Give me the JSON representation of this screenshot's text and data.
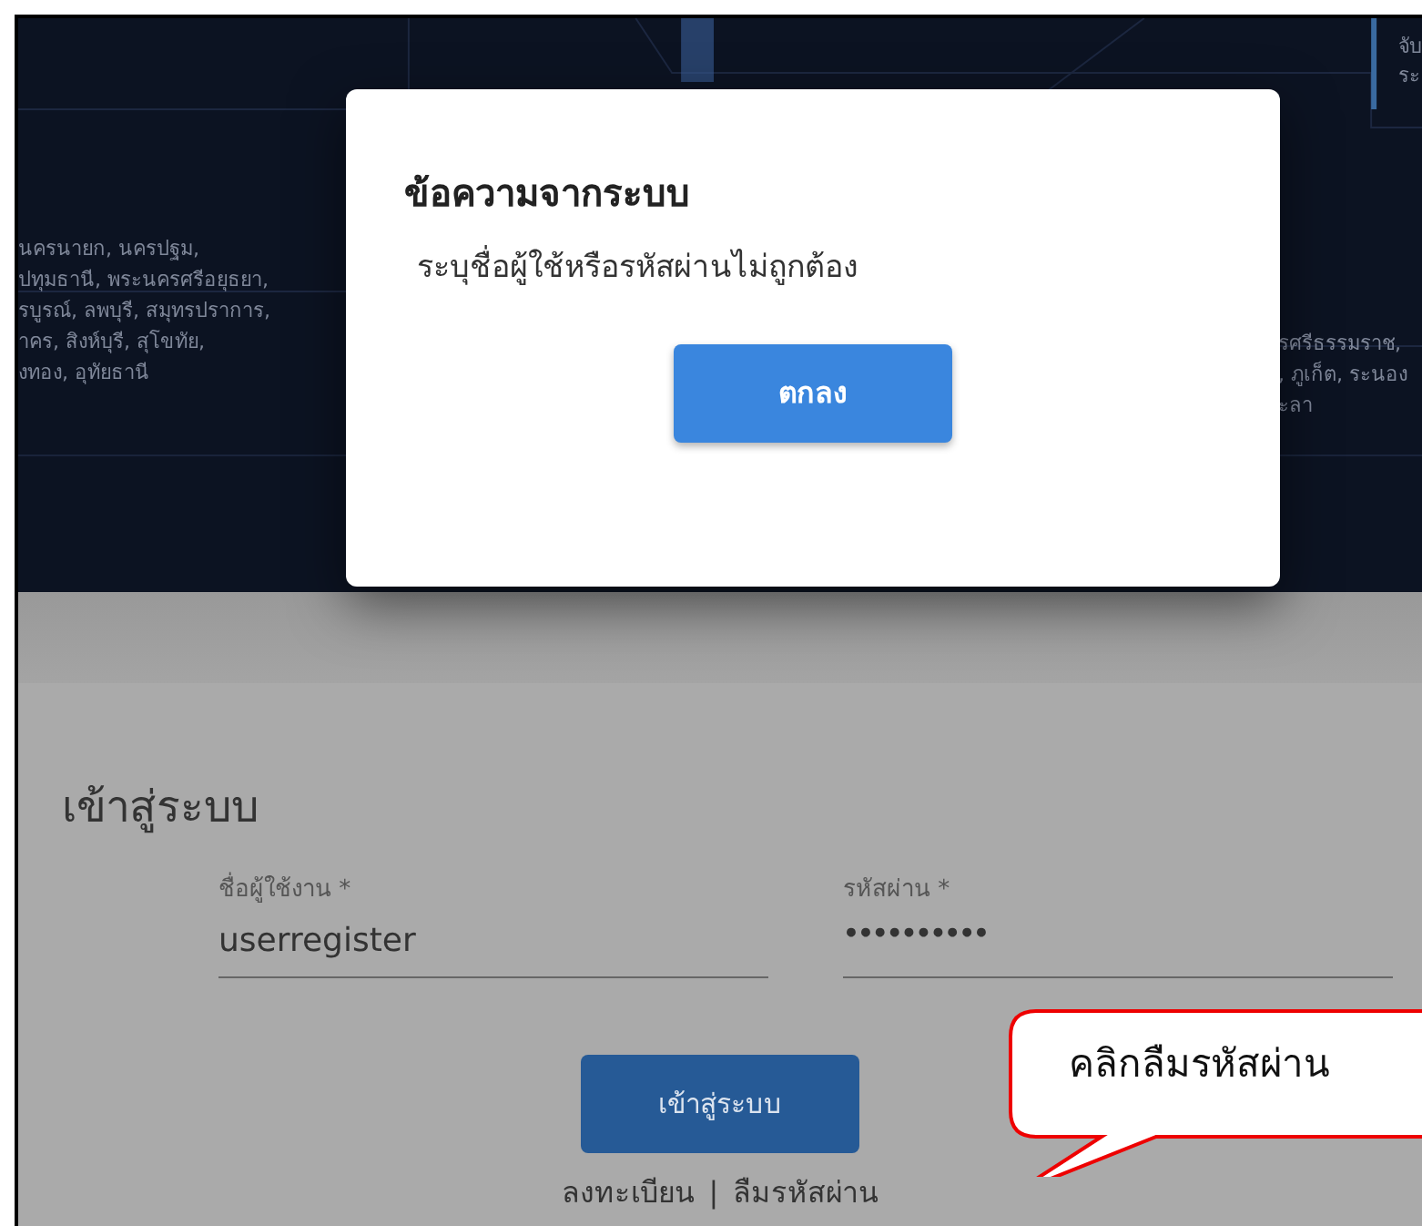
{
  "banner": {
    "left_lines": [
      "นครนายก, นครปฐม,",
      "ปทุมธานี, พระนครศรีอยุธยา,",
      "รบูรณ์, ลพบุรี, สมุทรปราการ,",
      "าคร, สิงห์บุรี, สุโขทัย,",
      "งทอง, อุทัยธานี"
    ],
    "top_right_lines": [
      "จับ",
      "ระ"
    ],
    "right_lines": [
      "รศรีธรรมราช,",
      ", ภูเก็ต, ระนอง",
      "ะลา"
    ]
  },
  "dialog": {
    "title": "ข้อความจากระบบ",
    "message": "ระบุชื่อผู้ใช้หรือรหัสผ่านไม่ถูกต้อง",
    "button": "ตกลง"
  },
  "login": {
    "title": "เข้าสู่ระบบ",
    "fields": [
      {
        "label": "ชื่อผู้ใช้งาน *",
        "value": "userregister",
        "kind": "text"
      },
      {
        "label": "รหัสผ่าน *",
        "value": "••••••••••",
        "kind": "password"
      }
    ],
    "button": "เข้าสู่ระบบ",
    "links": [
      "ลงทะเบียน",
      "ลืมรหัสผ่าน"
    ],
    "separator": "|"
  },
  "callout": {
    "text": "คลิกลืมรหัสผ่าน"
  }
}
